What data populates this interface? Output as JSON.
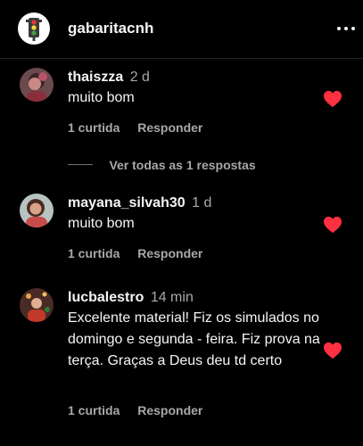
{
  "header": {
    "title": "gabaritacnh",
    "avatar_icon": "traffic-light-icon",
    "more_icon": "more-options-icon"
  },
  "comments": [
    {
      "username": "thaiszza",
      "time": "2 d",
      "text": "muito bom",
      "likes": "1 curtida",
      "reply_label": "Responder",
      "liked": true
    },
    {
      "username": "mayana_silvah30",
      "time": "1 d",
      "text": "muito bom",
      "likes": "1 curtida",
      "reply_label": "Responder",
      "liked": true
    },
    {
      "username": "lucbalestro",
      "time": "14 min",
      "text": "Excelente material! Fiz os simulados no domingo e segunda - feira. Fiz prova na terça. Graças a Deus deu td certo",
      "likes": "1 curtida",
      "reply_label": "Responder",
      "liked": true
    }
  ],
  "replies_toggle": {
    "label": "Ver todas as 1 respostas"
  },
  "colors": {
    "background": "#000000",
    "text_primary": "#f5f5f5",
    "text_secondary": "#a8a8a8",
    "heart": "#ff3040"
  }
}
